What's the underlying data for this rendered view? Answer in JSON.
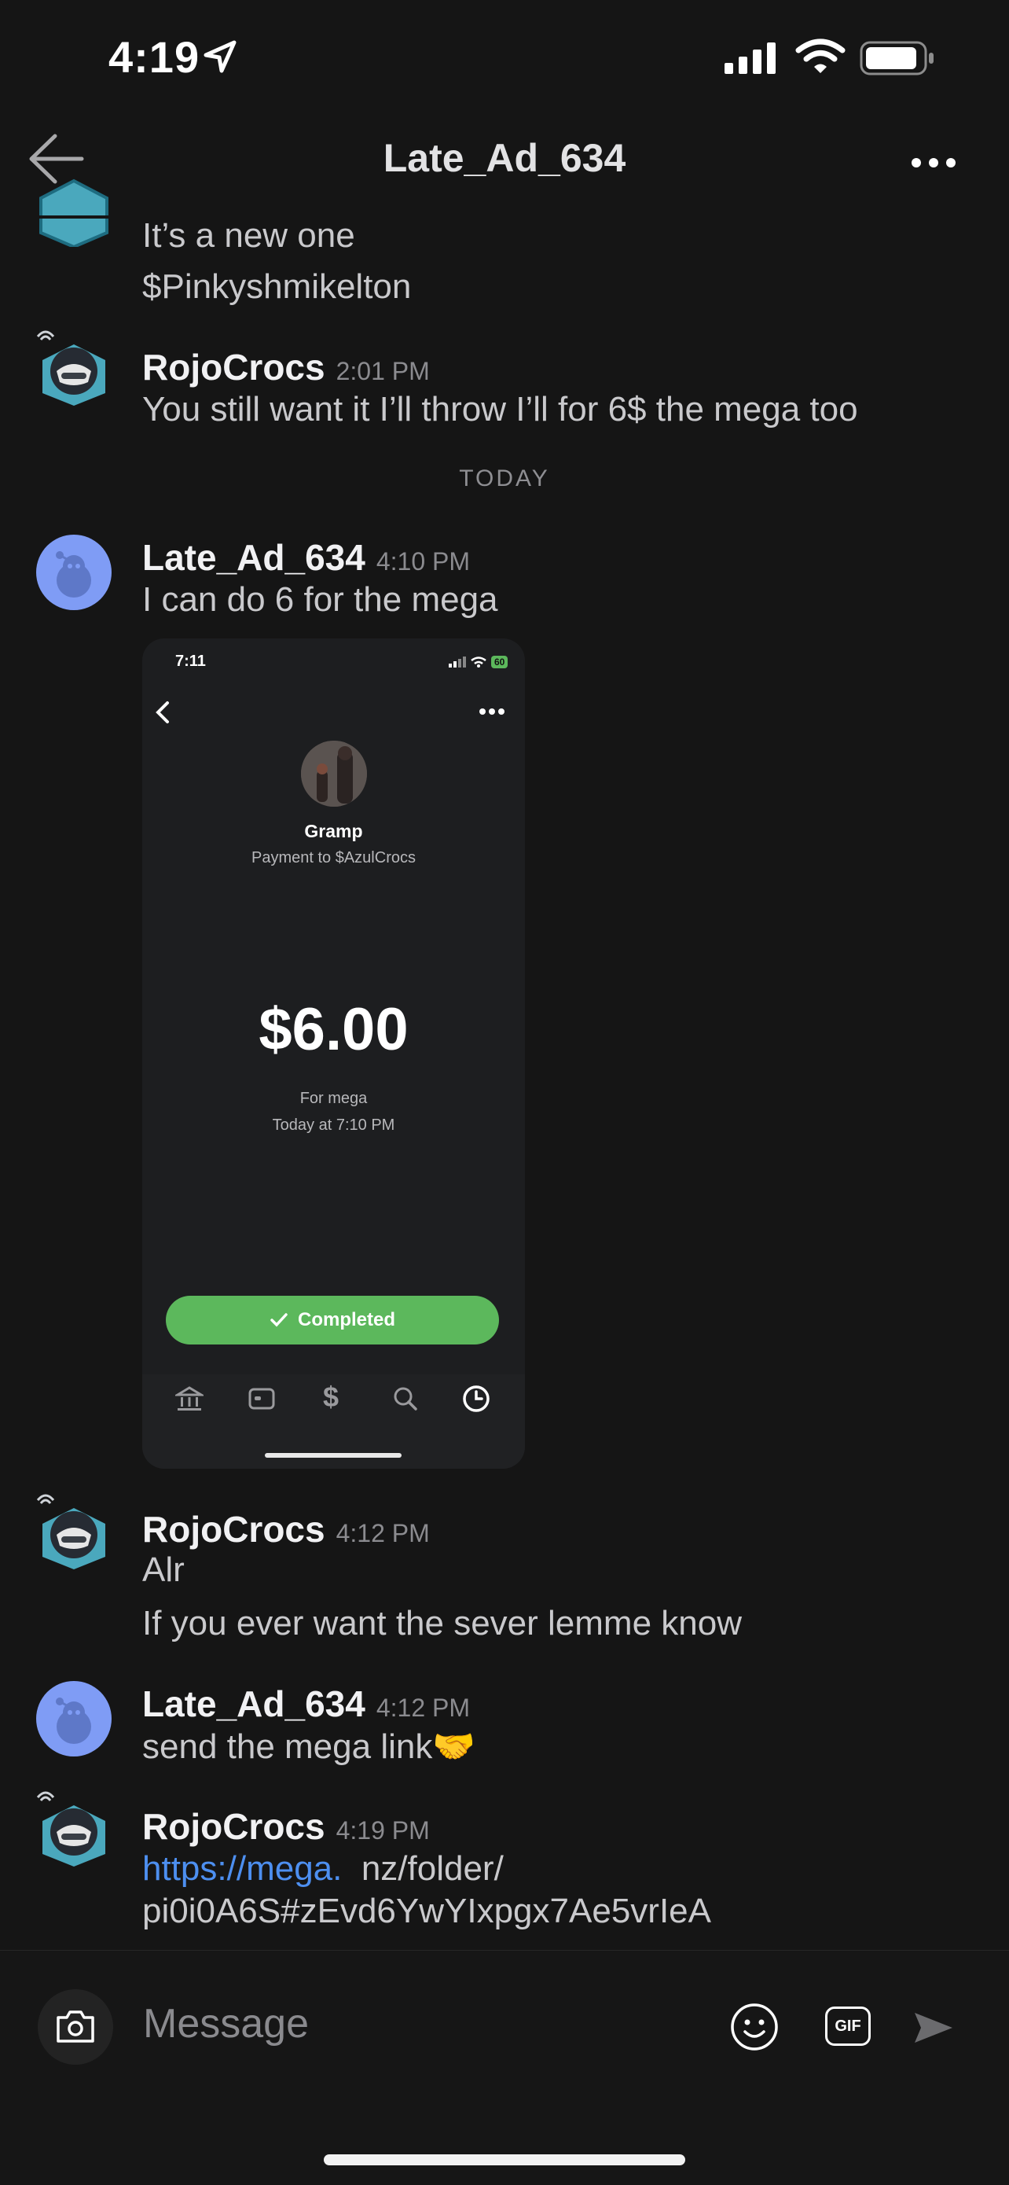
{
  "status_bar": {
    "time": "4:19"
  },
  "header": {
    "title": "Late_Ad_634"
  },
  "messages": [
    {
      "lines": [
        "It’s a new one",
        "$Pinkyshmikelton"
      ]
    },
    {
      "user": "RojoCrocs",
      "time": "2:01 PM",
      "lines": [
        "You still want it I’ll throw I’ll for 6$ the mega too"
      ]
    },
    {
      "user": "Late_Ad_634",
      "time": "4:10 PM",
      "lines": [
        "I can do 6 for the mega"
      ]
    },
    {
      "user": "RojoCrocs",
      "time": "4:12 PM",
      "lines": [
        "Alr",
        "If you ever want the sever lemme know"
      ]
    },
    {
      "user": "Late_Ad_634",
      "time": "4:12 PM",
      "lines": [
        "send the mega link🤝"
      ]
    },
    {
      "user": "RojoCrocs",
      "time": "4:19 PM",
      "link": "https://mega.",
      "lines": [
        "nz/folder/",
        "pi0i0A6S#zEvd6YwYIxpgx7Ae5vrIeA"
      ]
    }
  ],
  "date_divider": "TODAY",
  "payment_screenshot": {
    "time": "7:11",
    "battery": "60",
    "name": "Gramp",
    "subtitle": "Payment to $AzulCrocs",
    "amount": "$6.00",
    "note": "For mega",
    "date": "Today at 7:10 PM",
    "status": "Completed"
  },
  "composer": {
    "placeholder": "Message",
    "gif_label": "GIF"
  },
  "colors": {
    "background": "#151515",
    "link": "#4d8ff0",
    "completed": "#5cb85c",
    "avatar_blue": "#7f9cf5"
  }
}
